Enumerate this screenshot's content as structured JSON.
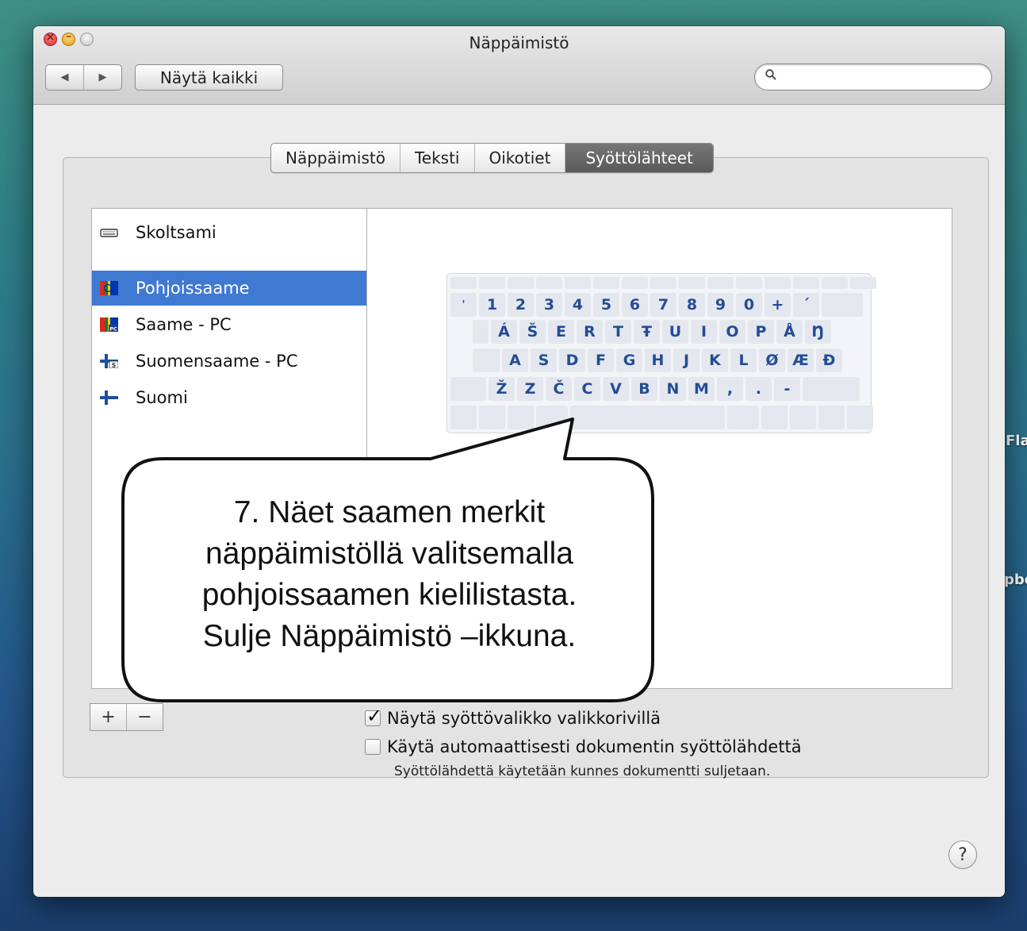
{
  "desktop": {
    "label_a": "Fla",
    "label_b": "pbe"
  },
  "window": {
    "title": "Näppäimistö",
    "nav_back": "◀",
    "nav_forward": "▶",
    "show_all_label": "Näytä kaikki",
    "search_placeholder": ""
  },
  "tabs": [
    {
      "label": "Näppäimistö",
      "active": false
    },
    {
      "label": "Teksti",
      "active": false
    },
    {
      "label": "Oikotiet",
      "active": false
    },
    {
      "label": "Syöttölähteet",
      "active": true
    }
  ],
  "input_sources": [
    {
      "label": "Skoltsami",
      "icon": "keyboard-icon",
      "selected": false
    },
    {
      "label": "Pohjoissaame",
      "icon": "sami-flag-icon",
      "selected": true
    },
    {
      "label": "Saame - PC",
      "icon": "sami-flag-pc-icon",
      "selected": false
    },
    {
      "label": "Suomensaame - PC",
      "icon": "finnish-flag-s-icon",
      "selected": false
    },
    {
      "label": "Suomi",
      "icon": "finnish-flag-icon",
      "selected": false
    }
  ],
  "keyboard": {
    "row1": [
      "'",
      "1",
      "2",
      "3",
      "4",
      "5",
      "6",
      "7",
      "8",
      "9",
      "0",
      "+",
      "´"
    ],
    "row2": [
      "Á",
      "Š",
      "E",
      "R",
      "T",
      "Ŧ",
      "U",
      "I",
      "O",
      "P",
      "Å",
      "Ŋ"
    ],
    "row3": [
      "A",
      "S",
      "D",
      "F",
      "G",
      "H",
      "J",
      "K",
      "L",
      "Ø",
      "Æ",
      "Đ"
    ],
    "row4": [
      "Ž",
      "Z",
      "Č",
      "C",
      "V",
      "B",
      "N",
      "M",
      ",",
      ".",
      "-"
    ]
  },
  "list_buttons": {
    "add": "+",
    "remove": "−"
  },
  "options": {
    "show_menu": {
      "label": "Näytä syöttövalikko valikkorivillä",
      "checked": true
    },
    "auto_switch": {
      "label": "Käytä automaattisesti dokumentin syöttölähdettä",
      "checked": false
    },
    "auto_switch_hint": "Syöttölähdettä käytetään kunnes dokumentti suljetaan."
  },
  "help_label": "?",
  "callout": {
    "line1": "7. Näet saamen merkit",
    "line2": "näppäimistöllä valitsemalla",
    "line3": "pohjoissaamen kielilistasta.",
    "line4": "Sulje Näppäimistö –ikkuna."
  },
  "colors": {
    "selection": "#3f79d2",
    "key_text": "#244c96",
    "tab_active": "#6a6a6a"
  }
}
